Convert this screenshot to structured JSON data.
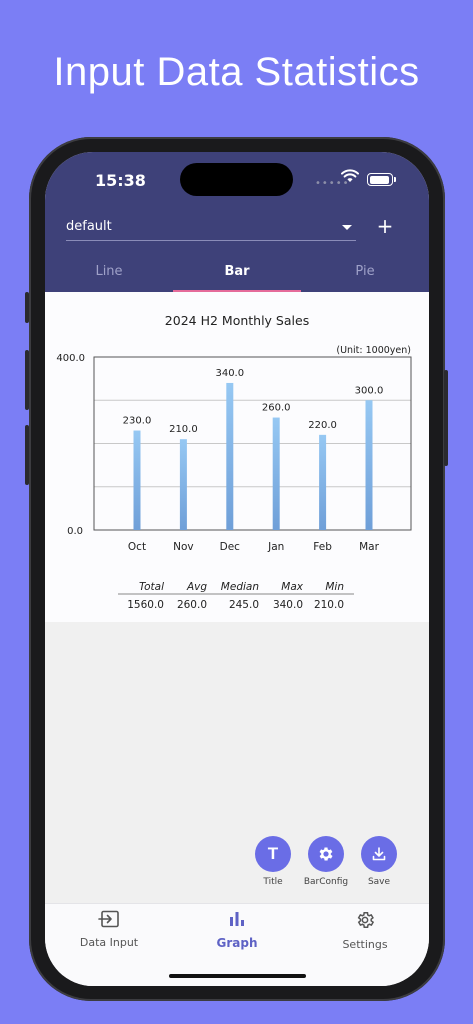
{
  "promo": {
    "title": "Input Data Statistics"
  },
  "status_bar": {
    "time": "15:38",
    "signal_dots": "•••••"
  },
  "header": {
    "dataset_value": "default",
    "add_label": "+",
    "tabs": [
      {
        "label": "Line",
        "active": false
      },
      {
        "label": "Bar",
        "active": true
      },
      {
        "label": "Pie",
        "active": false
      }
    ]
  },
  "chart_data": {
    "type": "bar",
    "title": "2024 H2 Monthly Sales",
    "unit_note": "(Unit: 1000yen)",
    "categories": [
      "Oct",
      "Nov",
      "Dec",
      "Jan",
      "Feb",
      "Mar"
    ],
    "values": [
      230.0,
      210.0,
      340.0,
      260.0,
      220.0,
      300.0
    ],
    "value_labels": [
      "230.0",
      "210.0",
      "340.0",
      "260.0",
      "220.0",
      "300.0"
    ],
    "ylim": [
      0,
      400
    ],
    "y_tick_labels": [
      "400.0",
      "0.0"
    ],
    "gridlines": [
      100,
      200,
      300
    ],
    "bar_color": "#7fb2ea"
  },
  "stats": {
    "headers": [
      "Total",
      "Avg",
      "Median",
      "Max",
      "Min"
    ],
    "values": [
      "1560.0",
      "260.0",
      "245.0",
      "340.0",
      "210.0"
    ]
  },
  "actions": [
    {
      "label": "Title",
      "icon": "T"
    },
    {
      "label": "BarConfig",
      "icon": "gear-icon"
    },
    {
      "label": "Save",
      "icon": "download-icon"
    }
  ],
  "bottom_nav": [
    {
      "label": "Data Input",
      "icon": "input-icon"
    },
    {
      "label": "Graph",
      "icon": "bar-chart-icon"
    },
    {
      "label": "Settings",
      "icon": "gear-icon"
    }
  ],
  "colors": {
    "background": "#7b7ef5",
    "header": "#3e4179",
    "accent": "#6a6de6",
    "tab_indicator": "#e56b9a"
  }
}
